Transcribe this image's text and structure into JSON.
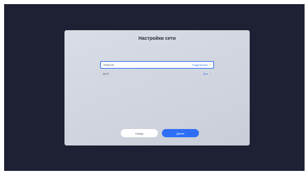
{
  "dialog": {
    "title": "Настройки сети"
  },
  "network": {
    "ethernet": {
      "label": "Ethernet",
      "status": "Подключено"
    },
    "wifi": {
      "label": "Wi-Fi",
      "status": "Вкл."
    }
  },
  "buttons": {
    "back": "Назад",
    "next": "Далее"
  },
  "colors": {
    "accent": "#2f6ff5",
    "screen_bg": "#1d2133",
    "dialog_bg": "#d2d6de"
  },
  "icons": {
    "row_arrow": "chevron-right-icon"
  }
}
